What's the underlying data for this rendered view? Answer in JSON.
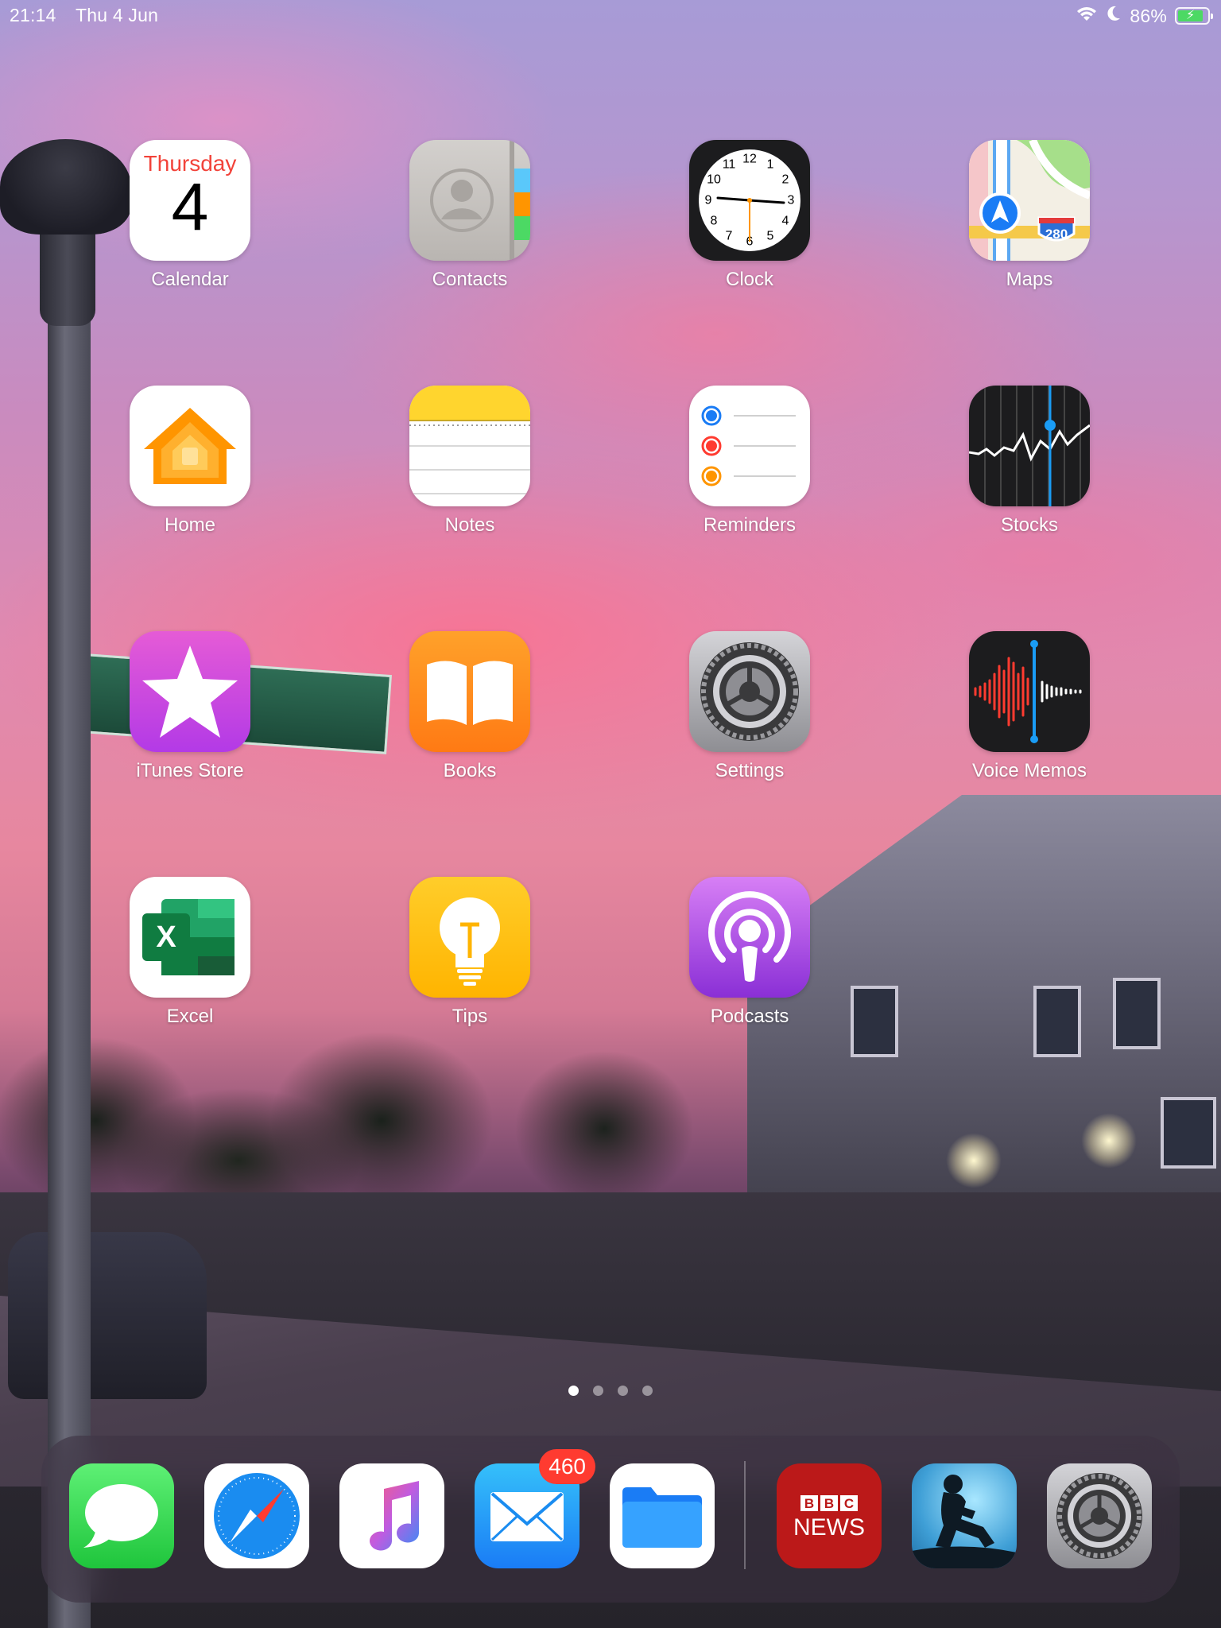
{
  "status_bar": {
    "time": "21:14",
    "date": "Thu 4 Jun",
    "battery_percent": "86%",
    "battery_level": 0.86,
    "icons": [
      "wifi-icon",
      "moon-icon",
      "battery-charging-icon"
    ]
  },
  "apps": [
    {
      "label": "Calendar",
      "icon": "calendar-icon",
      "day_name": "Thursday",
      "day_number": "4"
    },
    {
      "label": "Contacts",
      "icon": "contacts-icon"
    },
    {
      "label": "Clock",
      "icon": "clock-icon",
      "numerals": [
        "12",
        "1",
        "2",
        "3",
        "4",
        "5",
        "6",
        "7",
        "8",
        "9",
        "10",
        "11"
      ]
    },
    {
      "label": "Maps",
      "icon": "maps-icon",
      "shield": "280"
    },
    {
      "label": "Home",
      "icon": "home-icon"
    },
    {
      "label": "Notes",
      "icon": "notes-icon"
    },
    {
      "label": "Reminders",
      "icon": "reminders-icon"
    },
    {
      "label": "Stocks",
      "icon": "stocks-icon"
    },
    {
      "label": "iTunes Store",
      "icon": "star-icon"
    },
    {
      "label": "Books",
      "icon": "open-book-icon"
    },
    {
      "label": "Settings",
      "icon": "gear-icon"
    },
    {
      "label": "Voice Memos",
      "icon": "waveform-icon"
    },
    {
      "label": "Excel",
      "icon": "excel-icon",
      "letter": "X"
    },
    {
      "label": "Tips",
      "icon": "lightbulb-icon"
    },
    {
      "label": "Podcasts",
      "icon": "podcasts-icon"
    }
  ],
  "page_dots": {
    "count": 4,
    "active": 0
  },
  "dock": {
    "apps": [
      {
        "name": "Messages",
        "icon": "speech-bubble-icon"
      },
      {
        "name": "Safari",
        "icon": "compass-icon"
      },
      {
        "name": "Music",
        "icon": "music-note-icon"
      },
      {
        "name": "Mail",
        "icon": "envelope-icon",
        "badge": "460"
      },
      {
        "name": "Files",
        "icon": "folder-icon"
      },
      {
        "name": "BBC News",
        "icon": "bbc-news-icon",
        "logo_text": [
          "BBC",
          "NEWS"
        ]
      },
      {
        "name": "Kindle",
        "icon": "kindle-reader-icon"
      },
      {
        "name": "Settings",
        "icon": "gear-icon"
      }
    ]
  },
  "colors": {
    "calendar_red": "#f2433a",
    "badge_red": "#ff3b30",
    "battery_green": "#4cd964"
  }
}
